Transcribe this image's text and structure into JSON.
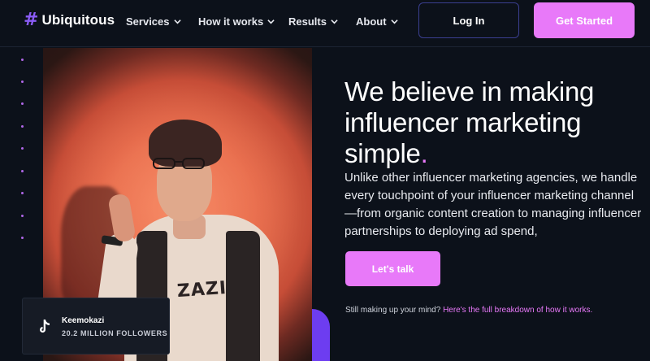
{
  "nav": {
    "brand_icon": "#",
    "brand_name": "Ubiquitous",
    "menu": [
      {
        "label": "Services"
      },
      {
        "label": "How it works"
      },
      {
        "label": "Results"
      },
      {
        "label": "About"
      }
    ],
    "login_label": "Log In",
    "cta_label": "Get Started"
  },
  "hero": {
    "headline": "We believe in making influencer marketing simple",
    "headline_period": ".",
    "subtext": "Unlike other influencer marketing agencies, we handle every touchpoint of your influencer marketing channel—from organic content creation to managing influencer partnerships to deploying ad spend,",
    "cta_label": "Let's talk",
    "still_text": "Still making up your mind? ",
    "still_link": "Here's the full breakdown of how it works."
  },
  "creator_card": {
    "icon": "tiktok-icon",
    "name": "Keemokazi",
    "followers": "20.2 MILLION FOLLOWERS"
  },
  "photo": {
    "shirt_print": "ZAZI"
  },
  "colors": {
    "background": "#0c111a",
    "accent_pink": "#e879f9",
    "accent_purple": "#8b5cf6",
    "login_border": "#3b3f91"
  }
}
